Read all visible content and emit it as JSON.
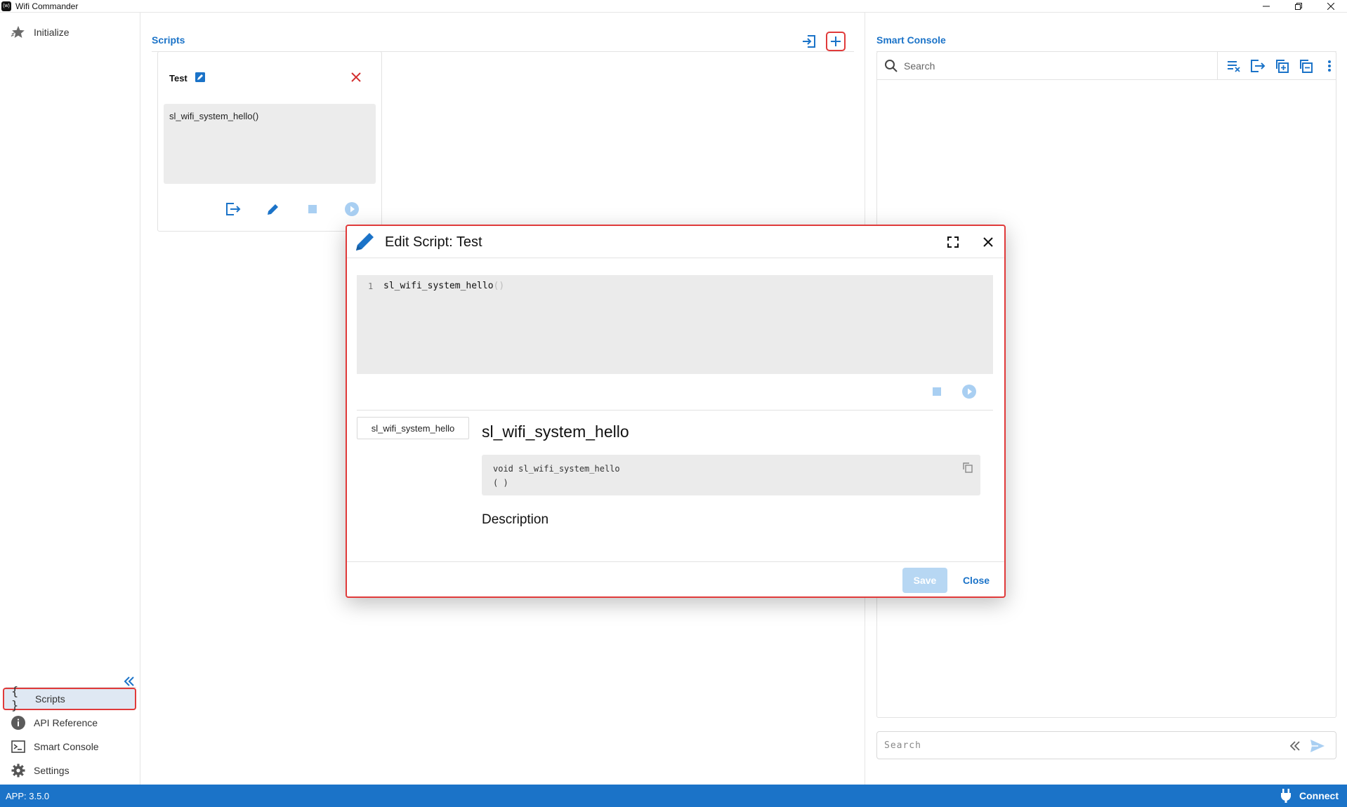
{
  "window": {
    "title": "Wifi Commander",
    "logo_text": "(w)"
  },
  "sidebar": {
    "top_items": [
      {
        "label": "Initialize",
        "icon": "star-icon"
      }
    ],
    "bottom_items": [
      {
        "label": "Scripts",
        "icon": "braces-icon",
        "active": true
      },
      {
        "label": "API Reference",
        "icon": "info-icon"
      },
      {
        "label": "Smart Console",
        "icon": "terminal-icon"
      },
      {
        "label": "Settings",
        "icon": "gear-icon"
      }
    ]
  },
  "scripts_panel": {
    "title": "Scripts",
    "card": {
      "title": "Test",
      "code": "sl_wifi_system_hello()"
    }
  },
  "console_panel": {
    "title": "Smart Console",
    "search_placeholder": "Search",
    "command_placeholder": "Search"
  },
  "status_bar": {
    "version": "APP: 3.5.0",
    "connect_label": "Connect"
  },
  "dialog": {
    "title": "Edit Script: Test",
    "editor": {
      "line_number": "1",
      "code": "sl_wifi_system_hello",
      "code_paren": "()"
    },
    "function_tab": "sl_wifi_system_hello",
    "function_name": "sl_wifi_system_hello",
    "signature": {
      "return_type": "void",
      "name": "sl_wifi_system_hello",
      "params": "( )"
    },
    "description_heading": "Description",
    "save_label": "Save",
    "close_label": "Close"
  },
  "colors": {
    "accent": "#1b73c8",
    "highlight_border": "#e03a3a",
    "disabled_button": "#b7d7f3",
    "code_bg": "#ebebeb"
  }
}
